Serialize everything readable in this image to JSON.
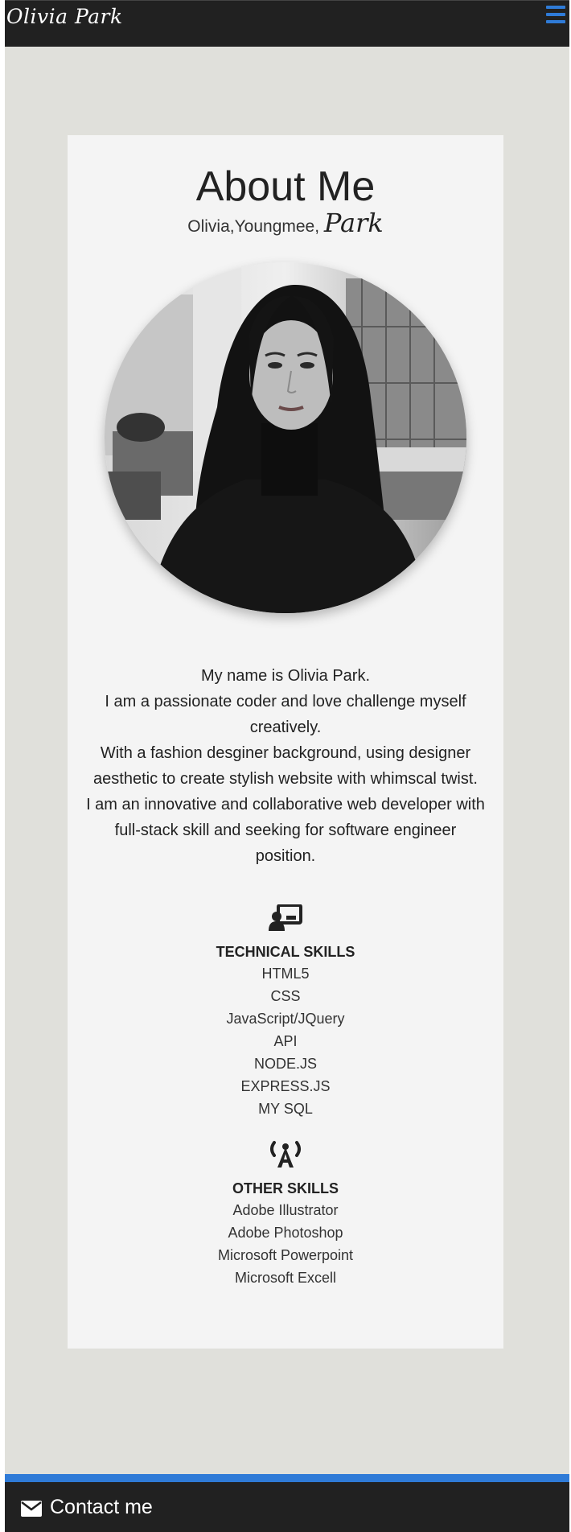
{
  "nav": {
    "brand": "Olivia Park",
    "menu_icon": "hamburger-menu-icon",
    "accent_color": "#2f7bd7",
    "background_color": "#212121"
  },
  "about": {
    "title": "About Me",
    "subtitle_plain": "Olivia,Youngmee,",
    "subtitle_script": "Park",
    "bio_lines": [
      "My name is Olivia Park.",
      "I am a passionate coder and love challenge myself creatively.",
      "With a fashion desginer background, using designer aesthetic to create stylish website with whimscal twist.",
      "I am an innovative and collaborative web developer with full-stack skill and seeking for software engineer position."
    ]
  },
  "technical_skills": {
    "icon": "user-presenting-icon",
    "heading": "TECHNICAL SKILLS",
    "items": [
      "HTML5",
      "CSS",
      "JavaScript/JQuery",
      "API",
      "NODE.JS",
      "EXPRESS.JS",
      "MY SQL"
    ]
  },
  "other_skills": {
    "icon": "broadcast-tower-icon",
    "heading": "OTHER SKILLS",
    "items": [
      "Adobe Illustrator",
      "Adobe Photoshop",
      "Microsoft Powerpoint",
      "Microsoft Excell"
    ]
  },
  "footer": {
    "icon": "envelope-icon",
    "contact_label": "Contact me",
    "accent_color": "#2f7bd7"
  }
}
